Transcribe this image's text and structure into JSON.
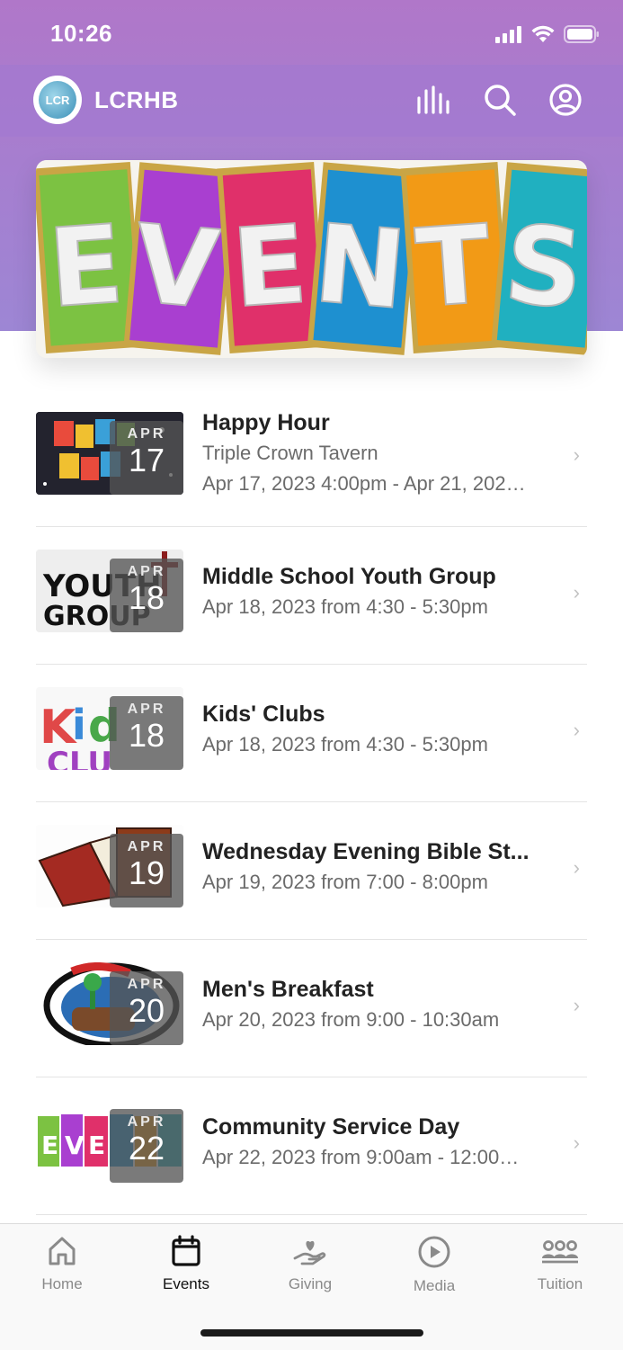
{
  "status": {
    "time": "10:26"
  },
  "header": {
    "logo_text": "LCR",
    "title": "LCRHB"
  },
  "banner": {
    "text": "EVENTS",
    "letters": [
      "E",
      "V",
      "E",
      "N",
      "T",
      "S"
    ],
    "colors": [
      "#7cc242",
      "#a93fd0",
      "#e0306a",
      "#1e90d0",
      "#f29a16",
      "#20b0c0"
    ]
  },
  "events": [
    {
      "title": "Happy Hour",
      "location": "Triple Crown Tavern",
      "time": "Apr 17, 2023 4:00pm - Apr 21, 202…",
      "month": "APR",
      "day": "17",
      "thumb": "happy-hour"
    },
    {
      "title": "Middle School Youth Group",
      "time": "Apr 18, 2023 from 4:30 - 5:30pm",
      "month": "APR",
      "day": "18",
      "thumb": "youth-group"
    },
    {
      "title": "Kids' Clubs",
      "time": "Apr 18, 2023 from 4:30 - 5:30pm",
      "month": "APR",
      "day": "18",
      "thumb": "kids-club"
    },
    {
      "title": "Wednesday Evening Bible St...",
      "time": "Apr 19, 2023 from 7:00 - 8:00pm",
      "month": "APR",
      "day": "19",
      "thumb": "bible"
    },
    {
      "title": "Men's Breakfast",
      "time": "Apr 20, 2023 from 9:00 - 10:30am",
      "month": "APR",
      "day": "20",
      "thumb": "woodys-diner"
    },
    {
      "title": "Community Service Day",
      "time": "Apr 22, 2023 from 9:00am - 12:00…",
      "month": "APR",
      "day": "22",
      "thumb": "events"
    }
  ],
  "tabs": [
    {
      "label": "Home",
      "icon": "home-icon"
    },
    {
      "label": "Events",
      "icon": "calendar-icon",
      "active": true
    },
    {
      "label": "Giving",
      "icon": "giving-icon"
    },
    {
      "label": "Media",
      "icon": "play-icon"
    },
    {
      "label": "Tuition",
      "icon": "group-icon"
    }
  ]
}
